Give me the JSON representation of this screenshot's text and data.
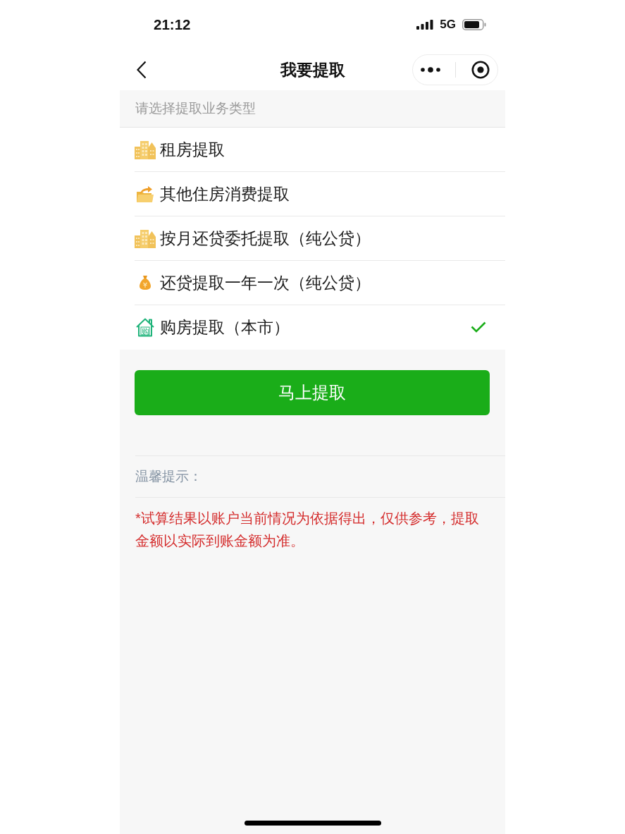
{
  "status_bar": {
    "time": "21:12",
    "network": "5G"
  },
  "nav_bar": {
    "title": "我要提取"
  },
  "section_header": "请选择提取业务类型",
  "options": [
    {
      "label": "租房提取",
      "kind": "buildings",
      "selected": false
    },
    {
      "label": "其他住房消费提取",
      "kind": "folder",
      "selected": false
    },
    {
      "label": "按月还贷委托提取（纯公贷）",
      "kind": "buildings",
      "selected": false
    },
    {
      "label": "还贷提取一年一次（纯公贷）",
      "kind": "money-bag",
      "selected": false
    },
    {
      "label": "购房提取（本市）",
      "kind": "house",
      "icon_text": "购",
      "selected": true
    }
  ],
  "submit_button": {
    "label": "马上提取"
  },
  "tips": {
    "title": "温馨提示：",
    "text": "*试算结果以账户当前情况为依据得出，仅供参考，提取金额以实际到账金额为准。"
  }
}
